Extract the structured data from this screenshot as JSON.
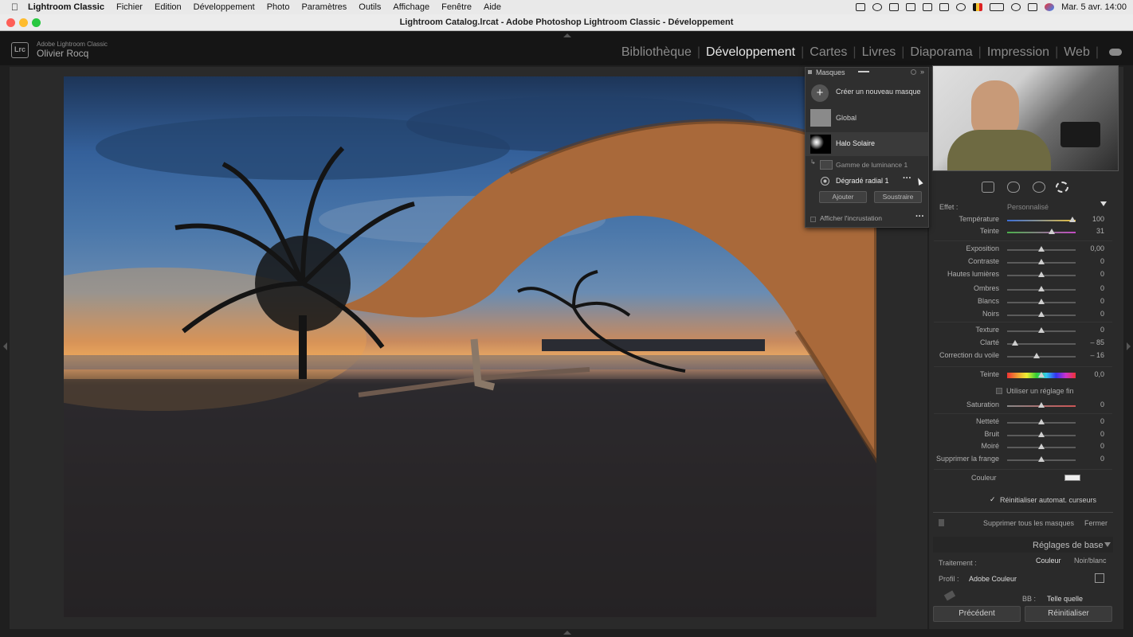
{
  "menubar": {
    "apple": "",
    "app": "Lightroom Classic",
    "items": [
      "Fichier",
      "Edition",
      "Développement",
      "Photo",
      "Paramètres",
      "Outils",
      "Affichage",
      "Fenêtre",
      "Aide"
    ],
    "datetime": "Mar. 5 avr.  14:00"
  },
  "window": {
    "title": "Lightroom Catalog.lrcat - Adobe Photoshop Lightroom Classic - Développement"
  },
  "header": {
    "logo": "Lrc",
    "app_name": "Adobe Lightroom Classic",
    "user_name": "Olivier Rocq",
    "modules": [
      "Bibliothèque",
      "Développement",
      "Cartes",
      "Livres",
      "Diaporama",
      "Impression",
      "Web"
    ],
    "active_module": "Développement"
  },
  "masks_panel": {
    "title": "Masques",
    "create_label": "Créer un nouveau masque",
    "mask_global": "Global",
    "mask_halo": "Halo Solaire",
    "component_luminance": "Gamme de luminance 1",
    "component_radial": "Dégradé radial 1",
    "add_label": "Ajouter",
    "subtract_label": "Soustraire",
    "overlay_label": "Afficher l'incrustation"
  },
  "effects": {
    "effect_label": "Effet :",
    "effect_value": "Personnalisé",
    "sliders": [
      {
        "label": "Température",
        "value": "100",
        "pos": 0.95
      },
      {
        "label": "Teinte",
        "value": "31",
        "pos": 0.65
      },
      {
        "label": "Exposition",
        "value": "0,00",
        "pos": 0.5
      },
      {
        "label": "Contraste",
        "value": "0",
        "pos": 0.5
      },
      {
        "label": "Hautes lumières",
        "value": "0",
        "pos": 0.5
      },
      {
        "label": "Ombres",
        "value": "0",
        "pos": 0.5
      },
      {
        "label": "Blancs",
        "value": "0",
        "pos": 0.5
      },
      {
        "label": "Noirs",
        "value": "0",
        "pos": 0.5
      },
      {
        "label": "Texture",
        "value": "0",
        "pos": 0.5
      },
      {
        "label": "Clarté",
        "value": "– 85",
        "pos": 0.12
      },
      {
        "label": "Correction du voile",
        "value": "– 16",
        "pos": 0.43
      },
      {
        "label": "Teinte",
        "value": "0,0",
        "pos": 0.5
      },
      {
        "label": "Saturation",
        "value": "0",
        "pos": 0.5
      },
      {
        "label": "Netteté",
        "value": "0",
        "pos": 0.5
      },
      {
        "label": "Bruit",
        "value": "0",
        "pos": 0.5
      },
      {
        "label": "Moiré",
        "value": "0",
        "pos": 0.5
      },
      {
        "label": "Supprimer la frange",
        "value": "0",
        "pos": 0.5
      }
    ],
    "fine_adjust_label": "Utiliser un réglage fin",
    "color_label": "Couleur",
    "reset_sliders_label": "Réinitialiser automat. curseurs",
    "delete_all_label": "Supprimer tous les masques",
    "close_label": "Fermer"
  },
  "basic": {
    "title": "Réglages de base",
    "treatment_label": "Traitement :",
    "color_option": "Couleur",
    "bw_option": "Noir/blanc",
    "profile_label": "Profil :",
    "profile_value": "Adobe Couleur",
    "wb_label": "BB :",
    "wb_value": "Telle quelle"
  },
  "footer": {
    "previous_label": "Précédent",
    "reset_label": "Réinitialiser"
  },
  "colors": {
    "temp_track": "#3b6ed8",
    "temp_track_end": "#e8c03b",
    "tint_track": "#4ab04a",
    "tint_track_end": "#c44ac4"
  }
}
